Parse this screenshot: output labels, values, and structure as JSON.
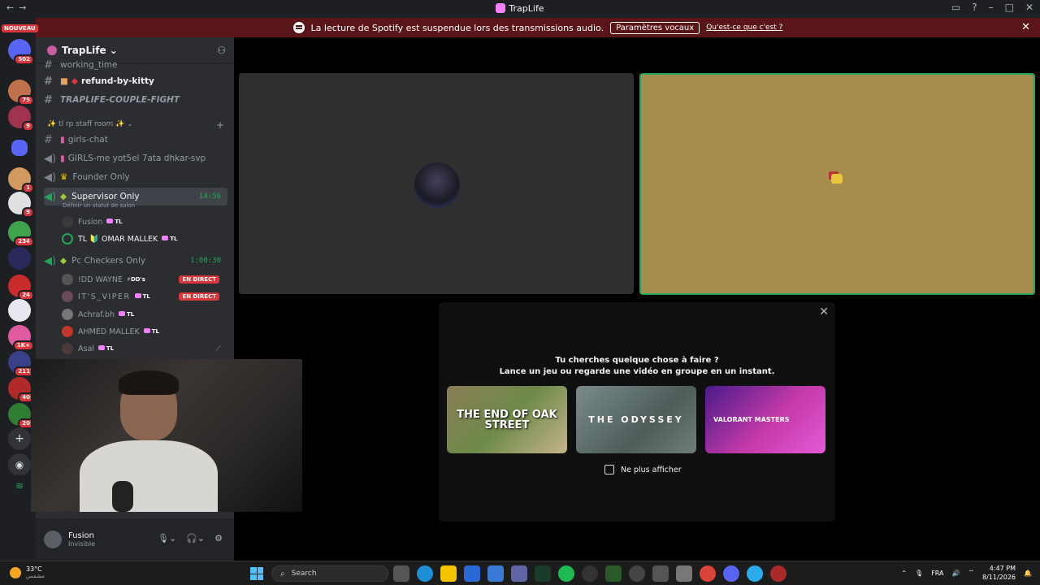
{
  "window": {
    "title": "TrapLife"
  },
  "notice": {
    "text": "La lecture de Spotify est suspendue lors des transmissions audio.",
    "button": "Paramètres vocaux",
    "link": "Qu'est-ce que c'est ?"
  },
  "guilds": {
    "new_badge": "NOUVEAU",
    "badges": [
      "502",
      "75",
      "9",
      "1",
      "9",
      "234",
      "24",
      "1K+",
      "211",
      "40",
      "20"
    ]
  },
  "server": {
    "name": "TrapLife"
  },
  "channels": {
    "working_time": "working_time",
    "refund": "refund-by-kitty",
    "couple_fight": "TRAPLIFE-COUPLE-FIGHT",
    "category": "tl rp staff room",
    "girls_chat": "girls-chat",
    "girls_me": "GIRLS-me yot5el 7ata dhkar-svp",
    "founder": "Founder Only",
    "supervisor": "Supervisor Only",
    "supervisor_time": "14:56",
    "supervisor_status": "Définir un statut de salon",
    "pc_checkers": "Pc Checkers Only",
    "pc_checkers_time": "1:00:30"
  },
  "voice_users": {
    "supervisor": [
      {
        "name": "Fusion",
        "tag": "TL"
      },
      {
        "name": "TL 🔰 OMAR MALLEK",
        "tag": "TL"
      }
    ],
    "pc_checkers": [
      {
        "name": "!DD WAYNE",
        "tag": "DD's",
        "live": "EN DIRECT"
      },
      {
        "name": "IT'S_VIPER",
        "tag": "TL",
        "live": "EN DIRECT"
      },
      {
        "name": "Achraf.bh",
        "tag": "TL"
      },
      {
        "name": "AHMED MALLEK",
        "tag": "TL"
      },
      {
        "name": "Asal",
        "tag": "TL"
      }
    ]
  },
  "user_panel": {
    "name": "Fusion",
    "status": "Invisible"
  },
  "activity_modal": {
    "line1": "Tu cherches quelque chose à faire ?",
    "line2": "Lance un jeu ou regarde une vidéo en groupe en un instant.",
    "cards": [
      "THE END OF OAK STREET",
      "THE ODYSSEY",
      "VALORANT MASTERS"
    ],
    "checkbox_label": "Ne plus afficher"
  },
  "taskbar": {
    "weather_temp": "33°C",
    "weather_sub": "مشمس",
    "search_placeholder": "Search",
    "lang": "FRA",
    "time": "4:47 PM",
    "date": "8/11/2026"
  }
}
